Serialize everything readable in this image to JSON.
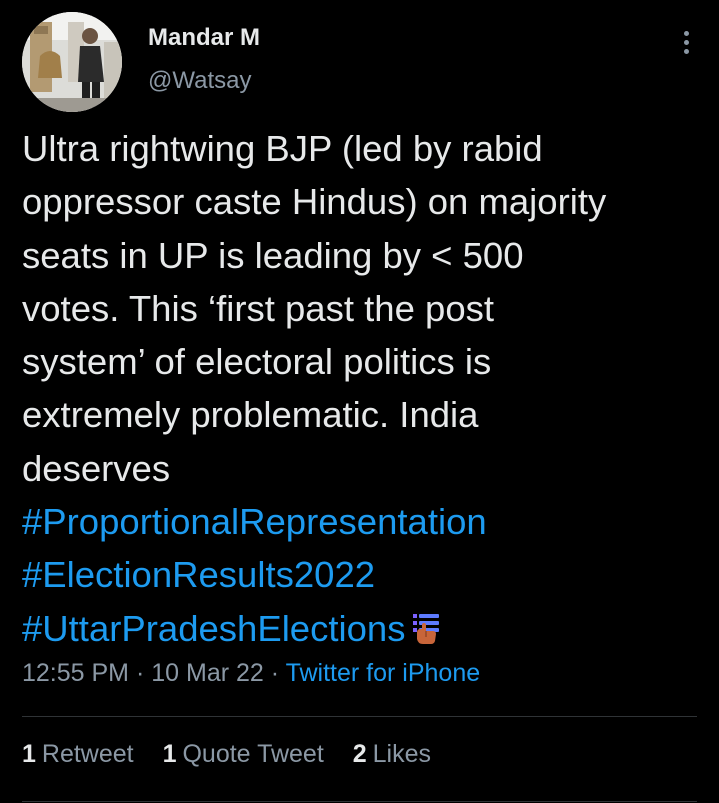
{
  "author": {
    "display_name": "Mandar M",
    "handle": "@Watsay",
    "avatar_icon": "profile-photo"
  },
  "more_icon": "more-options-icon",
  "tweet": {
    "lines": [
      "Ultra rightwing BJP (led by rabid",
      "oppressor caste Hindus) on majority",
      "seats in UP is leading by < 500",
      "votes. This ‘first past the post",
      "system’ of electoral politics is",
      "extremely problematic. India",
      "deserves"
    ],
    "hashtags": [
      "#ProportionalRepresentation",
      "#ElectionResults2022",
      "#UttarPradeshElections"
    ],
    "emoji": "ballot-box-with-hand-icon"
  },
  "meta": {
    "time": "12:55 PM",
    "separator": "·",
    "date": "10 Mar 22",
    "source": "Twitter for iPhone"
  },
  "stats": {
    "retweets_count": "1",
    "retweets_label": "Retweet",
    "quotes_count": "1",
    "quotes_label": "Quote Tweet",
    "likes_count": "2",
    "likes_label": "Likes"
  },
  "colors": {
    "background": "#000000",
    "text": "#e7e9ea",
    "secondary": "#8b98a5",
    "accent": "#1d9bf0",
    "divider": "#2f3336"
  }
}
